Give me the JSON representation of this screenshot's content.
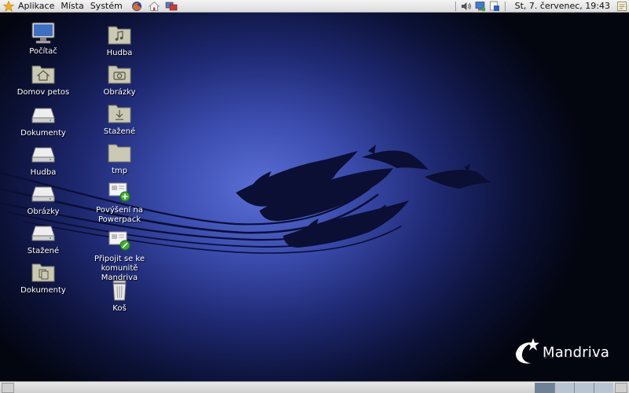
{
  "top_panel": {
    "menus": [
      "Aplikace",
      "Místa",
      "Systém"
    ],
    "launchers": [
      "firefox-icon",
      "home-icon",
      "network-icon"
    ],
    "tray_icons": [
      "volume-icon",
      "network-status-icon",
      "update-icon",
      "notes-icon"
    ],
    "clock": "St, 7. červenec, 19:43"
  },
  "desktop": {
    "column1": [
      {
        "label": "Počítač",
        "icon": "computer-icon"
      },
      {
        "label": "Domov petos",
        "icon": "home-folder-icon"
      },
      {
        "label": "Dokumenty",
        "icon": "drive-icon"
      },
      {
        "label": "Hudba",
        "icon": "drive-icon"
      },
      {
        "label": "Obrázky",
        "icon": "drive-icon"
      },
      {
        "label": "Stažené",
        "icon": "drive-icon"
      },
      {
        "label": "Dokumenty",
        "icon": "documents-folder-icon"
      }
    ],
    "column2": [
      {
        "label": "Hudba",
        "icon": "music-folder-icon"
      },
      {
        "label": "Obrázky",
        "icon": "pictures-folder-icon"
      },
      {
        "label": "Stažené",
        "icon": "downloads-folder-icon"
      },
      {
        "label": "tmp",
        "icon": "folder-icon"
      },
      {
        "label": "Povýšení na Powerpack",
        "icon": "upgrade-icon"
      },
      {
        "label": "Připojit se ke komunitě Mandriva",
        "icon": "community-icon"
      },
      {
        "label": "Koš",
        "icon": "trash-icon"
      }
    ]
  },
  "wallpaper": {
    "brand": "Mandriva"
  },
  "bottom_panel": {
    "workspaces": 4,
    "active_workspace": 1
  }
}
